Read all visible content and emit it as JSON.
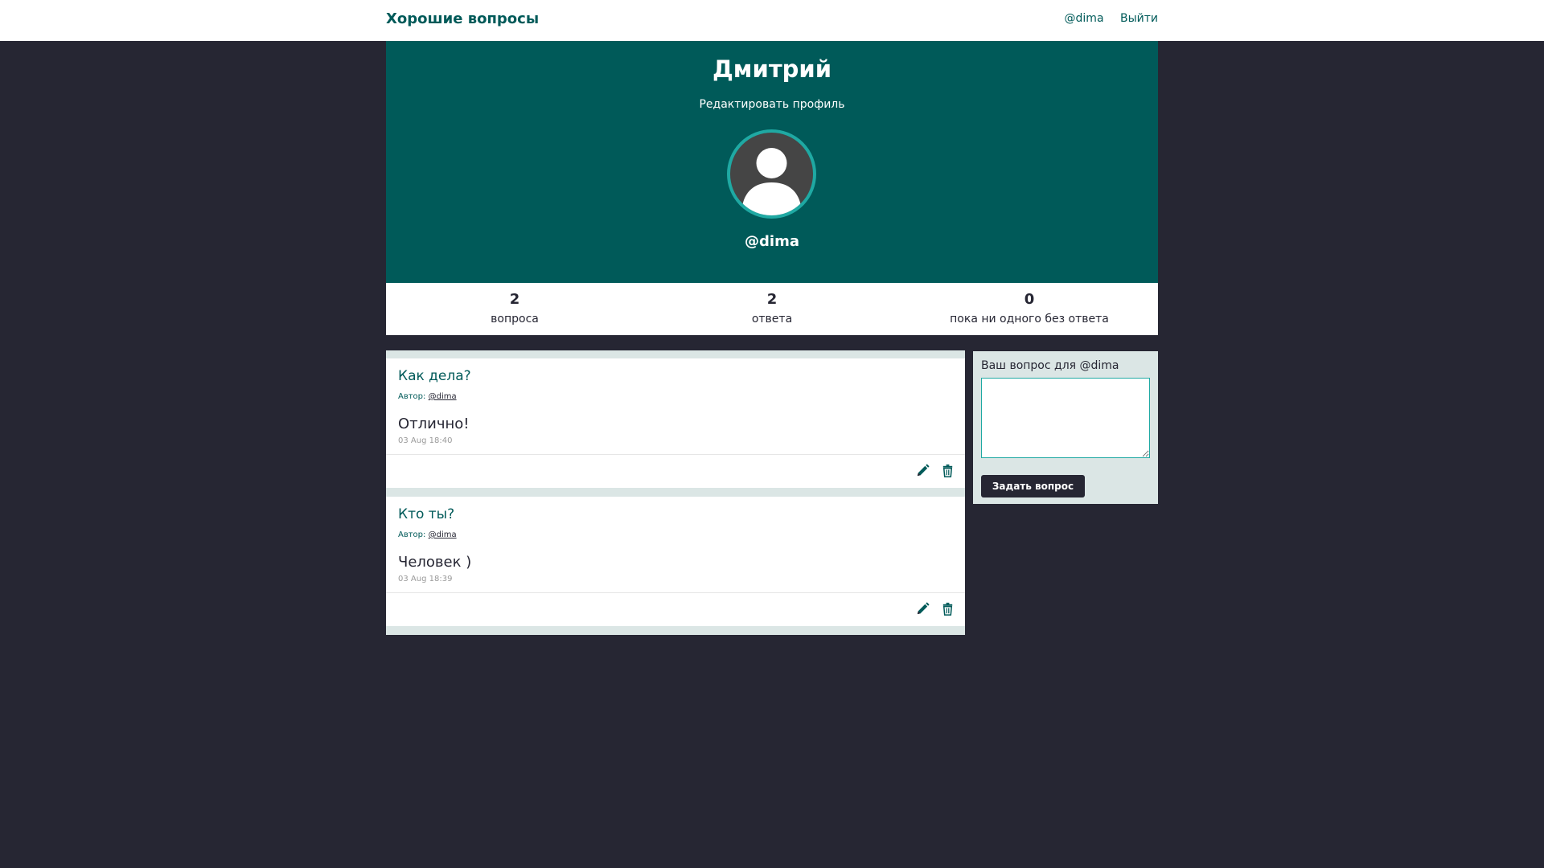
{
  "navbar": {
    "brand": "Хорошие вопросы",
    "user_link": "@dima",
    "logout": "Выйти"
  },
  "profile": {
    "name": "Дмитрий",
    "edit_link": "Редактировать профиль",
    "username": "@dima",
    "avatar_icon": "user-avatar-icon"
  },
  "stats": [
    {
      "value": "2",
      "label": "вопроса"
    },
    {
      "value": "2",
      "label": "ответа"
    },
    {
      "value": "0",
      "label": "пока ни одного без ответа"
    }
  ],
  "questions": [
    {
      "text": "Как дела?",
      "author_prefix": "Автор:",
      "author": "@dima",
      "answer": "Отлично!",
      "date": "03 Aug 18:40",
      "edit_icon": "pencil-icon",
      "delete_icon": "trash-icon"
    },
    {
      "text": "Кто ты?",
      "author_prefix": "Автор:",
      "author": "@dima",
      "answer": "Человек )",
      "date": "03 Aug 18:39",
      "edit_icon": "pencil-icon",
      "delete_icon": "trash-icon"
    }
  ],
  "ask": {
    "label": "Ваш вопрос для @dima",
    "placeholder": "",
    "button": "Задать вопрос"
  },
  "colors": {
    "primary": "#005a59",
    "accent": "#1fa9a3",
    "dark": "#262633",
    "light": "#dbe6e5"
  }
}
